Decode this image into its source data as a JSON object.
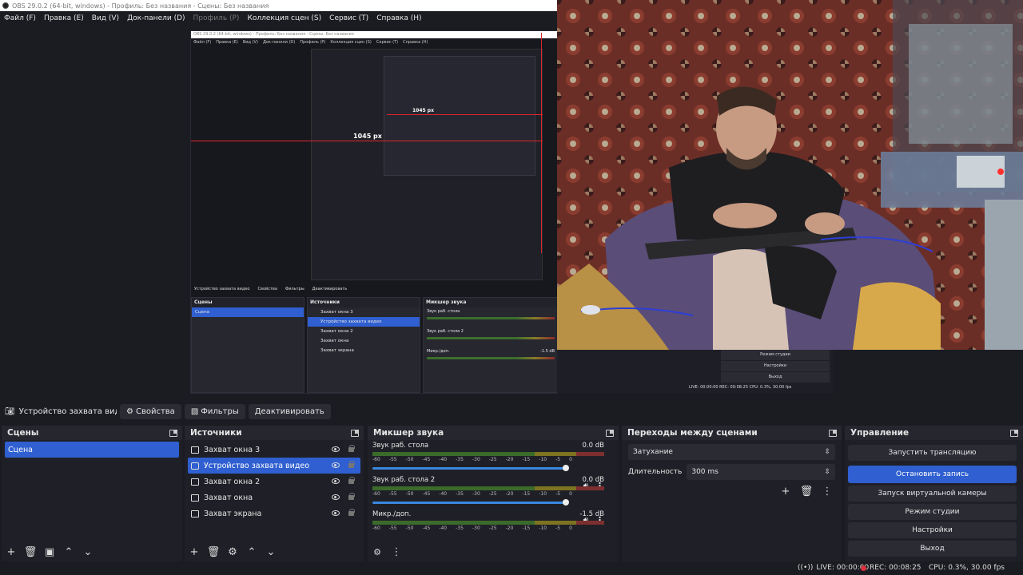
{
  "window": {
    "title": "OBS 29.0.2 (64-bit, windows) - Профиль: Без названия - Сцены: Без названия"
  },
  "menu": {
    "file": "Файл (F)",
    "edit": "Правка (E)",
    "view": "Вид (V)",
    "docks": "Док-панели (D)",
    "profile": "Профиль (P)",
    "scene_collection": "Коллекция сцен (S)",
    "tools": "Сервис (T)",
    "help": "Справка (H)"
  },
  "preview": {
    "measure_1045": "1045 px",
    "measure_small": "1045 px",
    "nested_toolbar": {
      "source": "Устройство захвата видео",
      "props": "Свойства",
      "filters": "Фильтры",
      "deactivate": "Деактивировать"
    },
    "nested_scenes": {
      "title": "Сцены",
      "item": "Сцена"
    },
    "nested_sources": {
      "title": "Источники",
      "items": [
        "Захват окна 3",
        "Устройство захвата видео",
        "Захват окна 2",
        "Захват окна",
        "Захват экрана"
      ]
    },
    "nested_mixer": {
      "title": "Микшер звука",
      "ch1": "Звук раб. стола",
      "ch2": "Звук раб. стола 2",
      "ch3": "Микр./доп.",
      "ch3_db": "-1.5 dB"
    },
    "cam_overlay": {
      "studio": "Режим студии",
      "settings": "Настройки",
      "exit": "Выход",
      "status": "LIVE: 00:00:00   REC: 00:08:25   CPU: 0.3%, 30.00 fps"
    }
  },
  "source_toolbar": {
    "source_name": "Устройство захвата видео",
    "properties": "Свойства",
    "filters": "Фильтры",
    "deactivate": "Деактивировать"
  },
  "scenes": {
    "title": "Сцены",
    "items": [
      "Сцена"
    ]
  },
  "sources": {
    "title": "Источники",
    "items": [
      "Захват окна 3",
      "Устройство захвата видео",
      "Захват окна 2",
      "Захват окна",
      "Захват экрана"
    ]
  },
  "mixer": {
    "title": "Микшер звука",
    "channels": [
      {
        "name": "Звук раб. стола",
        "db": "0.0 dB"
      },
      {
        "name": "Звук раб. стола 2",
        "db": "0.0 dB"
      },
      {
        "name": "Микр./доп.",
        "db": "-1.5 dB"
      }
    ],
    "scale": [
      "-60",
      "-55",
      "-50",
      "-45",
      "-40",
      "-35",
      "-30",
      "-25",
      "-20",
      "-15",
      "-10",
      "-5",
      "0"
    ]
  },
  "transitions": {
    "title": "Переходы между сценами",
    "selected": "Затухание",
    "duration_label": "Длительность",
    "duration_value": "300 ms"
  },
  "controls": {
    "title": "Управление",
    "start_stream": "Запустить трансляцию",
    "stop_recording": "Остановить запись",
    "virtual_cam": "Запуск виртуальной камеры",
    "studio_mode": "Режим студии",
    "settings": "Настройки",
    "exit": "Выход"
  },
  "status": {
    "live": "LIVE: 00:00:00",
    "rec": "REC: 00:08:25",
    "cpu": "CPU: 0.3%, 30.00 fps"
  },
  "colors": {
    "accent": "#2f5fd0",
    "rec": "#d9303c",
    "measure": "#e0242c"
  }
}
